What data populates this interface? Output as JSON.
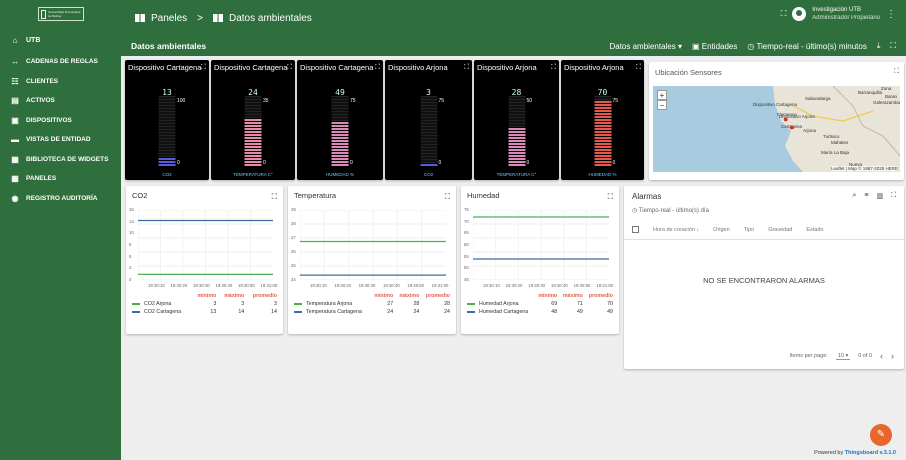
{
  "sidebar": {
    "logo_text": "Universidad Tecnológica de Bolívar",
    "items": [
      {
        "label": "UTB",
        "icon": "home-icon"
      },
      {
        "label": "CADENAS DE REGLAS",
        "icon": "rule-chain-icon"
      },
      {
        "label": "CLIENTES",
        "icon": "customers-icon"
      },
      {
        "label": "ACTIVOS",
        "icon": "assets-icon"
      },
      {
        "label": "DISPOSITIVOS",
        "icon": "devices-icon"
      },
      {
        "label": "VISTAS DE ENTIDAD",
        "icon": "entity-view-icon"
      },
      {
        "label": "BIBLIOTECA DE WIDGETS",
        "icon": "widgets-icon"
      },
      {
        "label": "PANELES",
        "icon": "dashboards-icon"
      },
      {
        "label": "REGISTRO AUDITORÍA",
        "icon": "audit-icon"
      }
    ]
  },
  "header": {
    "crumb1": "Paneles",
    "sep": ">",
    "crumb2": "Datos ambientales",
    "user_name": "Investigación UTB",
    "user_role": "Administrador Propietario"
  },
  "toolbar": {
    "title": "Datos ambientales",
    "state": "Datos ambientales ▾",
    "entities": "Entidades",
    "time": "Tiempo-real - último(s) minutos"
  },
  "devices": [
    {
      "title": "Dispositivo Cartagena",
      "value": "13",
      "max": "100",
      "caption": "CO2",
      "fill": 0.13,
      "color": "#5b5bd6"
    },
    {
      "title": "Dispositivo Cartagena",
      "value": "24",
      "max": "35",
      "caption": "TEMPERATURA C°",
      "fill": 0.69,
      "color": "#e58aa8"
    },
    {
      "title": "Dispositivo Cartagena",
      "value": "49",
      "max": "75",
      "caption": "HUMEDAD %",
      "fill": 0.65,
      "color": "#d98ab8"
    },
    {
      "title": "Dispositivo Arjona",
      "value": "3",
      "max": "75",
      "caption": "CO2",
      "fill": 0.04,
      "color": "#5b5bd6"
    },
    {
      "title": "Dispositivo Arjona",
      "value": "28",
      "max": "50",
      "caption": "TEMPERATURA C°",
      "fill": 0.56,
      "color": "#d98ab8"
    },
    {
      "title": "Dispositivo Arjona",
      "value": "70",
      "max": "75",
      "caption": "HUMEDAD %",
      "fill": 0.93,
      "color": "#e4574f"
    }
  ],
  "map": {
    "title": "Ubicación Sensores",
    "zoom_in": "+",
    "zoom_out": "−",
    "labels": [
      "Dispositivo Cartagena",
      "Dispositivo Arjona",
      "Sabanalarga",
      "Barranquilla",
      "Cartagena",
      "María La Baja",
      "Turbaco",
      "Arjona",
      "Mahates",
      "Nueva",
      "Zona",
      "Baran",
      "Flamenco",
      "Galerazamba"
    ],
    "attribution": "Leaflet | Map © 1987-2025 HERE"
  },
  "charts": [
    {
      "title": "CO2",
      "legend_head": [
        "mínimo",
        "máximo",
        "promedio"
      ],
      "rows": [
        {
          "name": "CO2 Arjona",
          "min": "3",
          "max": "3",
          "avg": "3",
          "color": "#4caf50"
        },
        {
          "name": "CO2 Cartagena",
          "min": "13",
          "max": "14",
          "avg": "14",
          "color": "#3a6ea5"
        }
      ],
      "yticks": [
        "15",
        "13",
        "10",
        "8",
        "5",
        "3",
        "0"
      ],
      "xticks": [
        "19:30:10",
        "19:30:20",
        "19:30:30",
        "19:30:40",
        "19:30:50",
        "19:31:00"
      ]
    },
    {
      "title": "Temperatura",
      "legend_head": [
        "mínimo",
        "máximo",
        "promedio"
      ],
      "rows": [
        {
          "name": "Temperatura Arjona",
          "min": "27",
          "max": "28",
          "avg": "28",
          "color": "#4caf50"
        },
        {
          "name": "Temperatura Cartagena",
          "min": "24",
          "max": "24",
          "avg": "24",
          "color": "#3a6ea5"
        }
      ],
      "yticks": [
        "29",
        "28",
        "27",
        "26",
        "25",
        "24"
      ],
      "xticks": [
        "19:30:10",
        "19:30:20",
        "19:30:30",
        "19:30:40",
        "19:30:50",
        "19:31:00"
      ]
    },
    {
      "title": "Humedad",
      "legend_head": [
        "mínimo",
        "máximo",
        "promedio"
      ],
      "rows": [
        {
          "name": "Humedad Arjona",
          "min": "69",
          "max": "71",
          "avg": "70",
          "color": "#4caf50"
        },
        {
          "name": "Humedad Cartagena",
          "min": "48",
          "max": "49",
          "avg": "49",
          "color": "#3a6ea5"
        }
      ],
      "yticks": [
        "75",
        "70",
        "65",
        "60",
        "55",
        "50",
        "45"
      ],
      "xticks": [
        "19:30:10",
        "19:30:20",
        "19:30:30",
        "19:30:40",
        "19:30:50",
        "19:31:00"
      ]
    }
  ],
  "alarms": {
    "title": "Alarmas",
    "sub": "Tiempo-real - último(s) día",
    "cols": [
      "Hora de creación ↓",
      "Origen",
      "Tipo",
      "Gravedad",
      "Estado"
    ],
    "empty": "NO SE ENCONTRARON ALARMAS",
    "per_page": "Items per page:",
    "per_page_val": "10",
    "range": "0 of 0"
  },
  "footer": {
    "prefix": "Powered by ",
    "brand": "Thingsboard v.3.1.0"
  }
}
